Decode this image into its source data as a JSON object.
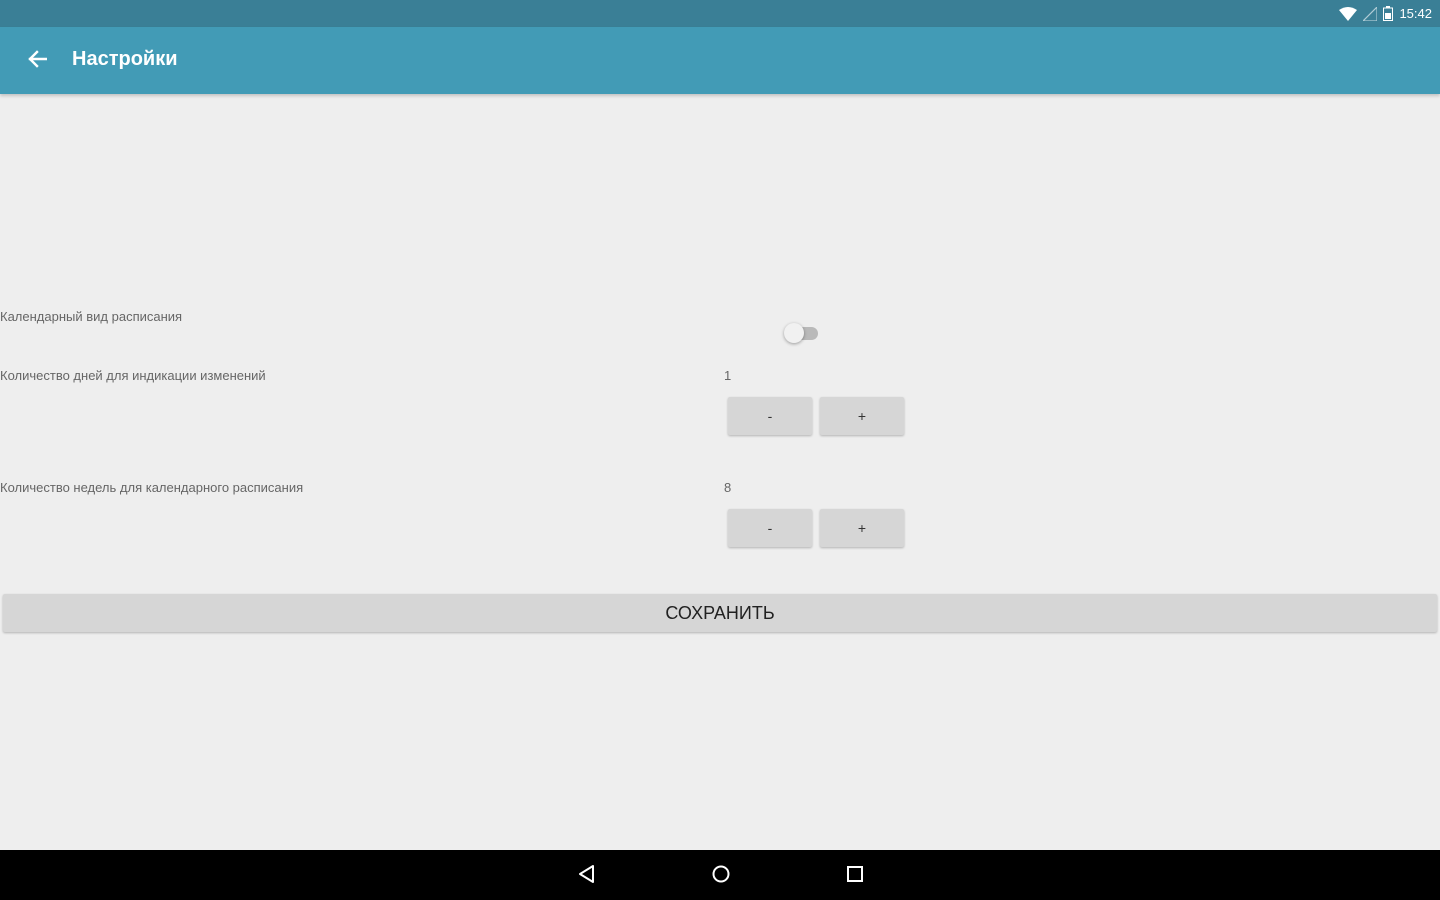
{
  "status_bar": {
    "time": "15:42"
  },
  "app_bar": {
    "title": "Настройки"
  },
  "settings": {
    "calendar_view": {
      "label": "Календарный вид расписания",
      "enabled": false
    },
    "change_days": {
      "label": "Количество дней для индикации изменений",
      "value": "1",
      "minus": "-",
      "plus": "+"
    },
    "calendar_weeks": {
      "label": "Количество недель для календарного расписания",
      "value": "8",
      "minus": "-",
      "plus": "+"
    }
  },
  "save_button": {
    "label": "СОХРАНИТЬ"
  },
  "icons": {
    "back": "arrow-back-icon",
    "wifi": "wifi-icon",
    "signal": "signal-icon",
    "battery": "battery-icon",
    "nav_back": "nav-back-icon",
    "nav_home": "nav-home-icon",
    "nav_recents": "nav-recents-icon"
  },
  "colors": {
    "status_bar": "#3a7f96",
    "app_bar": "#429bb6",
    "background": "#eeeeee",
    "button": "#d6d6d6",
    "nav_bar": "#000000"
  }
}
